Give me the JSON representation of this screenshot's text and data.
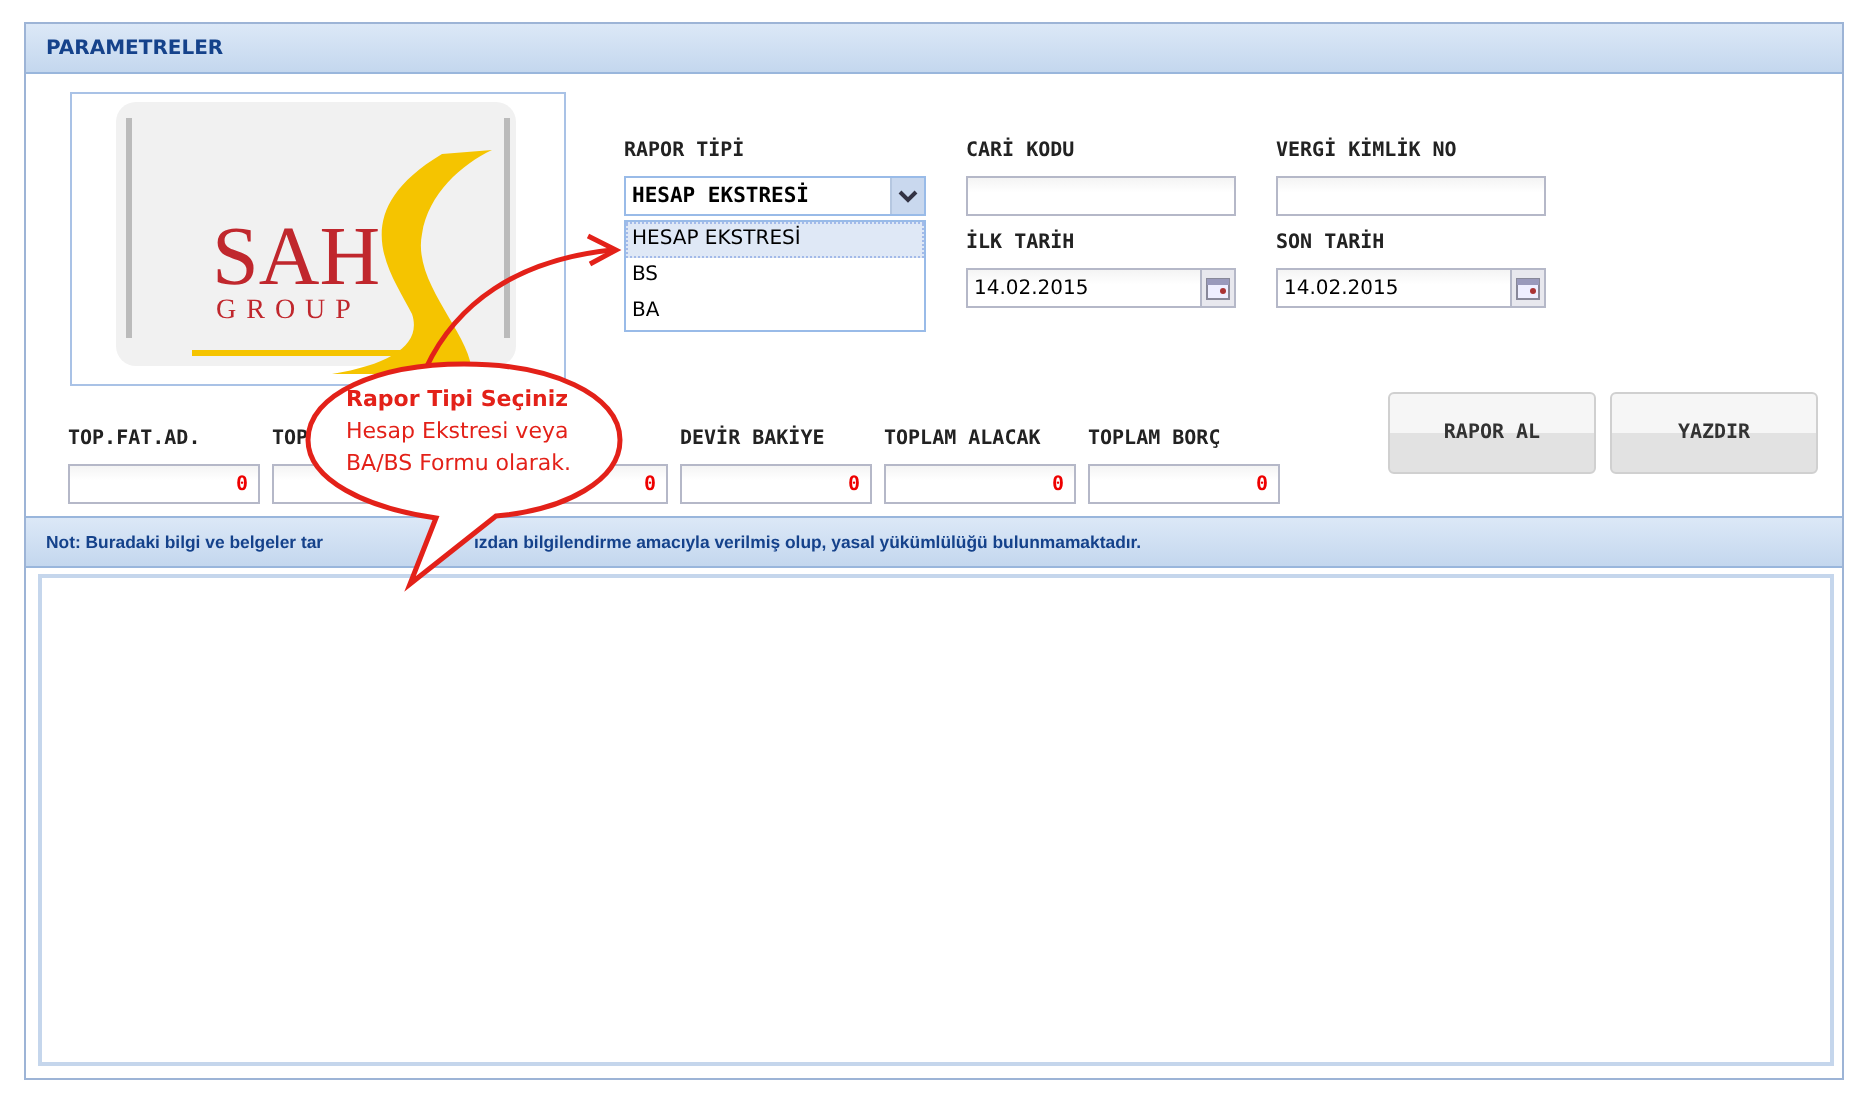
{
  "panel": {
    "title": "PARAMETRELER"
  },
  "logo": {
    "text": "SAH",
    "subtext": "GROUP"
  },
  "fields": [
    {
      "label": "RAPOR TİPİ",
      "kind": "select",
      "value": "HESAP EKSTRESİ",
      "expanded": true
    },
    {
      "label": "CARİ KODU",
      "kind": "text"
    },
    {
      "label": "VERGİ KİMLİK NO",
      "kind": "text"
    },
    {
      "label": "İLK TARİH",
      "kind": "date",
      "value": "14.02.2015"
    },
    {
      "label": "SON TARİH",
      "kind": "date",
      "value": "14.02.2015"
    }
  ],
  "dropdown_options": [
    {
      "label": "HESAP EKSTRESİ",
      "selected": true
    },
    {
      "label": "BS",
      "selected": false
    },
    {
      "label": "BA",
      "selected": false
    }
  ],
  "totals": [
    {
      "label": "TOP.FAT.AD.",
      "value": "0"
    },
    {
      "label": "TOP"
    },
    {
      "value": "0"
    },
    {
      "label": "DEVİR BAKİYE",
      "value": "0"
    },
    {
      "label": "TOPLAM ALACAK",
      "value": "0"
    },
    {
      "label": "TOPLAM BORÇ",
      "value": "0"
    }
  ],
  "buttons": [
    "RAPOR AL",
    "YAZDIR"
  ],
  "note": [
    "Not: Buradaki bilgi ve belgeler tar",
    "ızdan bilgilendirme amacıyla verilmiş olup, yasal yükümlülüğü bulunmamaktadır."
  ],
  "callout": {
    "title": "Rapor Tipi Seçiniz",
    "text": "Hesap Ekstresi veya BA/BS Formu olarak."
  }
}
